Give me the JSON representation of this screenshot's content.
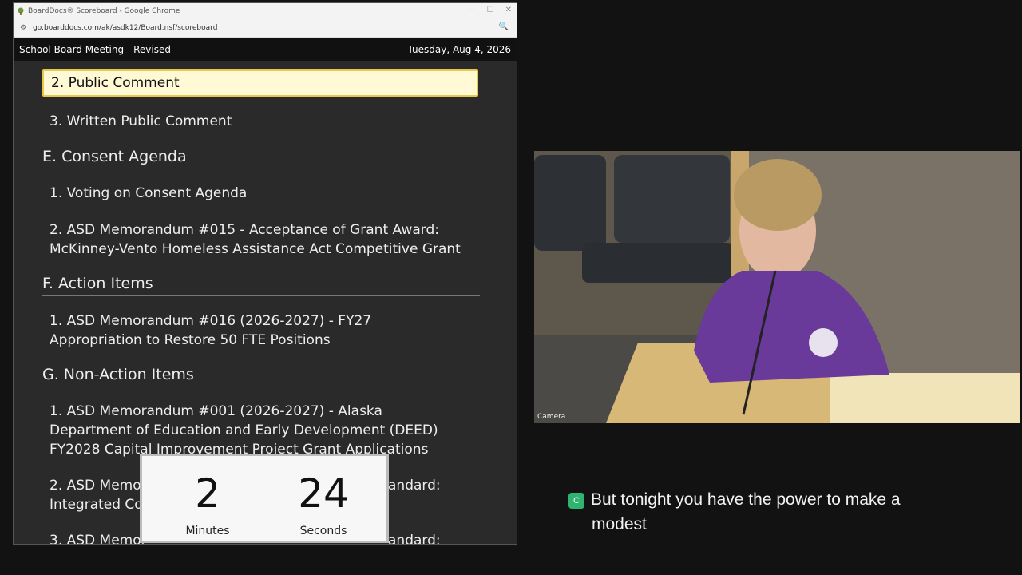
{
  "window": {
    "title": "BoardDocs® Scoreboard - Google Chrome",
    "url": "go.boarddocs.com/ak/asdk12/Board.nsf/scoreboard"
  },
  "header": {
    "meeting_title": "School Board Meeting - Revised",
    "date": "Tuesday, Aug 4, 2026"
  },
  "agenda": {
    "current_item": "2. Public Comment",
    "items": [
      {
        "label": "3. Written Public Comment"
      },
      {
        "section": "E. Consent Agenda"
      },
      {
        "label": "1. Voting on Consent Agenda"
      },
      {
        "label": "2. ASD Memorandum #015 - Acceptance of Grant Award: McKinney-Vento Homeless Assistance Act Competitive Grant"
      },
      {
        "section": "F. Action Items"
      },
      {
        "label": "1. ASD Memorandum #016 (2026-2027) - FY27 Appropriation to Restore 50 FTE Positions"
      },
      {
        "section": "G. Non-Action Items"
      },
      {
        "label": "1. ASD Memorandum #001 (2026-2027) - Alaska Department of Education and Early Development (DEED) FY2028 Capital Improvement Project Grant Applications"
      },
      {
        "label": "2. ASD Memor",
        "label_right": "andard:",
        "label_line2": "Integrated Co"
      },
      {
        "label": "3. ASD Memor",
        "label_right": "andard:"
      }
    ]
  },
  "timer": {
    "minutes": "2",
    "minutes_label": "Minutes",
    "seconds": "24",
    "seconds_label": "Seconds"
  },
  "video": {
    "label": "Camera"
  },
  "captions": {
    "badge": "C",
    "line1": "But tonight you have the power to make a",
    "line2": "modest"
  }
}
